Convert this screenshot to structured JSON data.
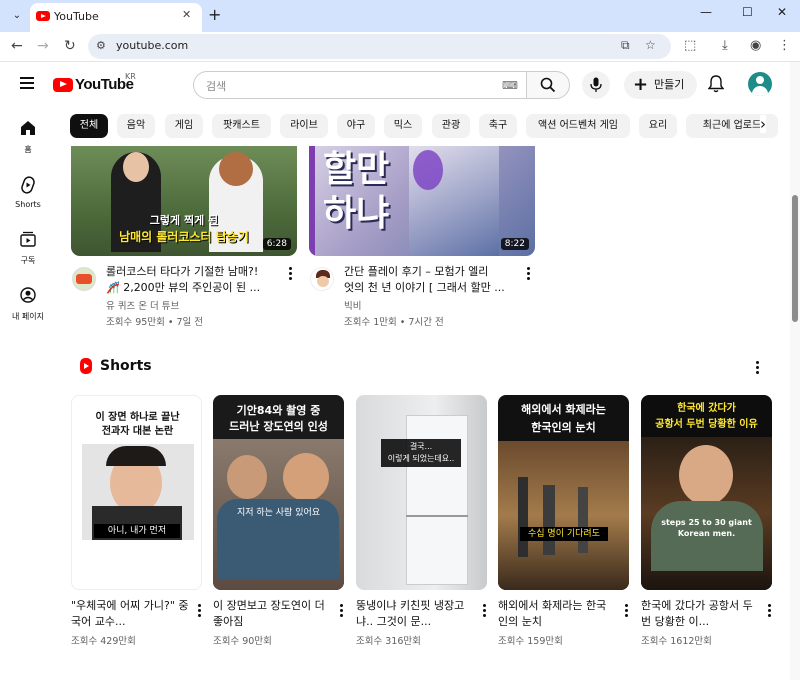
{
  "browser": {
    "tab_title": "YouTube",
    "url": "youtube.com",
    "new_tab": "+",
    "close_tab": "✕",
    "tab_menu": "⌄",
    "controls": {
      "minimize": "—",
      "maximize": "☐",
      "close": "✕"
    }
  },
  "header": {
    "logo": "YouTube",
    "country": "KR",
    "search_placeholder": "검색",
    "create_label": "만들기"
  },
  "sidebar": {
    "items": [
      {
        "label": "홈",
        "icon": "home-icon"
      },
      {
        "label": "Shorts",
        "icon": "shorts-icon"
      },
      {
        "label": "구독",
        "icon": "subscriptions-icon"
      },
      {
        "label": "내 페이지",
        "icon": "account-icon"
      }
    ]
  },
  "chips": [
    "전체",
    "음악",
    "게임",
    "팟캐스트",
    "라이브",
    "야구",
    "믹스",
    "관광",
    "축구",
    "액션 어드벤처 게임",
    "요리",
    "최근에 업로드"
  ],
  "videos": [
    {
      "title_line1": "롤러코스터 타다가 기절한 남매?!",
      "title_line2": "🎢 2,200만 뷰의 주인공이 된 ...",
      "channel": "유 퀴즈 온 더 튜브",
      "meta": "조회수 95만회 • 7일 전",
      "duration": "6:28",
      "overlay_top": "그렇게 찍게 된",
      "overlay_bottom": "남매의 롤러코스터 탑승기"
    },
    {
      "title_line1": "간단 플레이 후기 – 모험가 엘리",
      "title_line2": "엇의 천 년 이야기 [ 그래서 할만 ...",
      "channel": "빅비",
      "meta": "조회수 1만회 • 7시간 전",
      "duration": "8:22",
      "overlay_top": "할만",
      "overlay_bottom": "하냐"
    }
  ],
  "shorts": {
    "title": "Shorts",
    "items": [
      {
        "title": "\"우체국에 어찌 가니?\" 중국어 교수...",
        "views": "조회수 429만회",
        "overlay": "이 장면 하나로 끝난\n전과자 대본 논란",
        "caption": "아니, 내가 먼저"
      },
      {
        "title": "이 장면보고 장도연이 더 좋아짐",
        "views": "조회수 90만회",
        "overlay": "기안84와 촬영 중\n드러난 장도연의 인성",
        "caption": "지저 하는 사람 있어요"
      },
      {
        "title": "뚱냉이냐 키친핏 냉장고냐.. 그것이 문...",
        "views": "조회수 316만회",
        "overlay": "결국...\n이렇게 되었는데요..",
        "caption": ""
      },
      {
        "title": "해외에서 화제라는 한국인의 눈치",
        "views": "조회수 159만회",
        "overlay": "해외에서 화제라는\n한국인의 눈치",
        "caption": "수십 명이 기다려도"
      },
      {
        "title": "한국에 갔다가 공항서 두번 당황한 이...",
        "views": "조회수 1612만회",
        "overlay": "한국에 갔다가\n공항서 두번 당황한 이유",
        "caption": "steps 25 to 30 giant\nKorean men."
      }
    ]
  }
}
